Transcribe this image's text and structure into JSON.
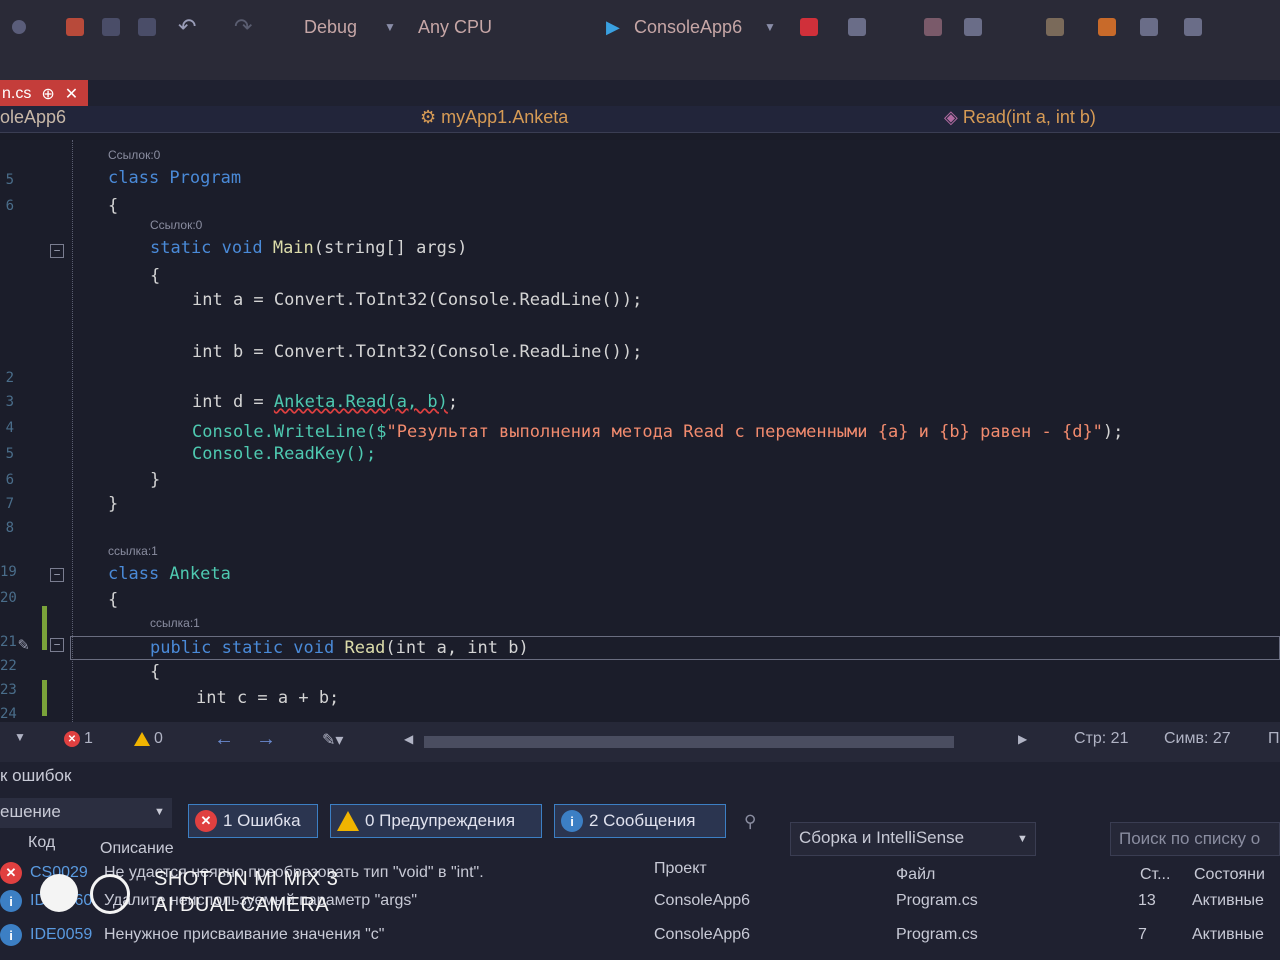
{
  "toolbar": {
    "config": "Debug",
    "platform": "Any CPU",
    "run_target": "ConsoleApp6"
  },
  "tabs": {
    "file_tab_label": "n.cs",
    "file_tab_pin": "⊕",
    "file_tab_close": "✕",
    "project_label": "oleApp6"
  },
  "navbar": {
    "class_label": "myApp1.Anketa",
    "member_label": "Read(int a, int b)"
  },
  "editor": {
    "line_numbers": [
      "5",
      "6",
      "",
      "",
      "",
      "",
      "",
      "",
      "2",
      "3",
      "4",
      "5",
      "6",
      "7",
      "8",
      "",
      "19",
      "20",
      "",
      "21",
      "22",
      "23",
      "24"
    ],
    "lens": {
      "refs0_a": "Ссылок:0",
      "refs0_b": "Ссылок:0",
      "refs1_class": "ссылка:1",
      "refs1_method": "ссылка:1"
    },
    "lines": {
      "class_program": "class Program",
      "open1": "{",
      "main_sig_kw": "static void ",
      "main_sig_name": "Main",
      "main_sig_rest": "(string[] args)",
      "open2": "{",
      "line_a": "int a = Convert.ToInt32(Console.ReadLine());",
      "line_b": "int b = Convert.ToInt32(Console.ReadLine());",
      "line_d_pre": "int d = ",
      "line_d_err": "Anketa.Read(a, b)",
      "line_d_post": ";",
      "wl_pre": "Console.WriteLine($",
      "wl_str": "\"Результат выполнения метода Read с переменными {a} и {b} равен - {d}\"",
      "wl_post": ");",
      "readkey": "Console.ReadKey();",
      "close2": "}",
      "close1": "}",
      "class_anketa_kw": "class ",
      "class_anketa_name": "Anketa",
      "open3": "{",
      "read_sig_kw": "public static void ",
      "read_sig_name": "Read",
      "read_sig_rest": "(int a, int b)",
      "open4": "{",
      "line_c": "int c = a + b;"
    }
  },
  "status": {
    "errors": "1",
    "warnings": "0",
    "row": "Стр: 21",
    "col": "Симв: 27",
    "extra": "П"
  },
  "error_panel": {
    "title": "к ошибок",
    "scope": "ешение",
    "btn_errors": "1 Ошибка",
    "btn_warnings": "0 Предупреждения",
    "btn_messages": "2 Сообщения",
    "build_filter": "Сборка и IntelliSense",
    "search_placeholder": "Поиск по списку о",
    "col_code": "Код",
    "col_desc": "Описание",
    "col_project": "Проект",
    "col_file": "Файл",
    "col_line": "Ст...",
    "col_state": "Состояни",
    "rows": [
      {
        "code": "CS0029",
        "desc": "Не удается неявно преобразовать тип \"void\" в \"int\".",
        "project": "",
        "file": "",
        "line": "",
        "state": ""
      },
      {
        "code": "IDE0060",
        "desc": "Удалите неиспользуемый параметр \"args\"",
        "project": "ConsoleApp6",
        "file": "Program.cs",
        "line": "13",
        "state": "Активные"
      },
      {
        "code": "IDE0059",
        "desc": "Ненужное присваивание значения \"c\"",
        "project": "ConsoleApp6",
        "file": "Program.cs",
        "line": "7",
        "state": "Активные"
      }
    ]
  },
  "watermark": {
    "line1": "SHOT ON MI MIX 3",
    "line2": "AI DUAL CAMERA"
  },
  "colors": {
    "error_red": "#e04040",
    "warning_yellow": "#f0b400",
    "info_blue": "#3c7fc4",
    "accent_tab": "#c43d3a"
  }
}
